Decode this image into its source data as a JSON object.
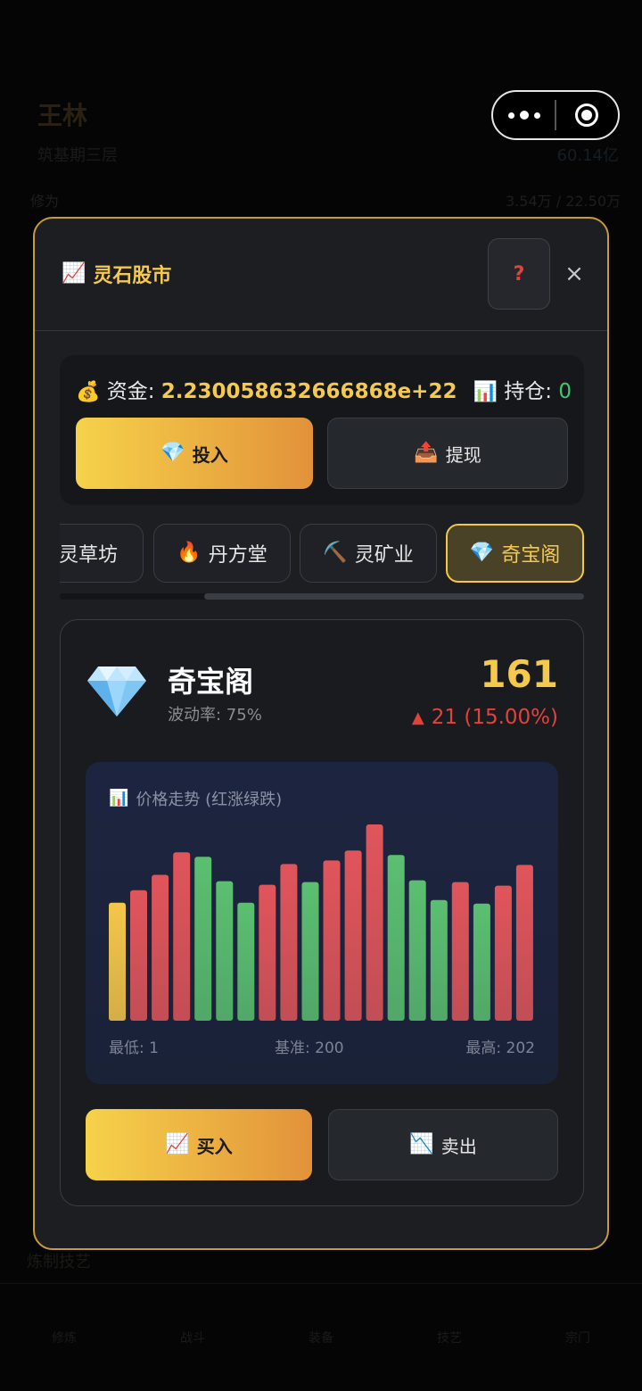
{
  "background": {
    "user_name": "王林",
    "subtitle": "筑基期三层",
    "stat_label": "修为",
    "stat_value": "3.54万 / 22.50万",
    "gems": "60.14亿",
    "section": "炼制技艺",
    "nav": [
      "修炼",
      "战斗",
      "装备",
      "技艺",
      "宗门"
    ]
  },
  "modal": {
    "title": "灵石股市",
    "title_icon": "chart-up-icon",
    "help_label": "?",
    "close_label": "×"
  },
  "funds": {
    "funds_label": "资金:",
    "funds_value": "2.230058632666868e+22",
    "hold_label": "持仓:",
    "hold_value": "0",
    "invest_label": "投入",
    "withdraw_label": "提现"
  },
  "tabs": [
    {
      "label": "灵草坊",
      "icon": "herb-icon",
      "active": false
    },
    {
      "label": "丹方堂",
      "icon": "fire-icon",
      "active": false
    },
    {
      "label": "灵矿业",
      "icon": "pickaxe-icon",
      "active": false
    },
    {
      "label": "奇宝阁",
      "icon": "gem-icon",
      "active": true
    }
  ],
  "stock": {
    "name": "奇宝阁",
    "volatility": "波动率: 75%",
    "price": "161",
    "change": "21 (15.00%)",
    "change_arrow": "▲",
    "buy_label": "买入",
    "sell_label": "卖出"
  },
  "chart_data": {
    "type": "bar",
    "title": "价格走势 (红涨绿跌)",
    "min_label": "最低: 1",
    "base_label": "基准: 200",
    "max_label": "最高: 202",
    "values": [
      131,
      145,
      162,
      187,
      182,
      155,
      131,
      151,
      174,
      154,
      178,
      189,
      218,
      184,
      156,
      134,
      154,
      130,
      150,
      173
    ],
    "colors": [
      "yellow",
      "red",
      "red",
      "red",
      "green",
      "green",
      "green",
      "red",
      "red",
      "green",
      "red",
      "red",
      "red",
      "green",
      "green",
      "green",
      "red",
      "green",
      "red",
      "red"
    ],
    "palette": {
      "yellow": "#f4c64a",
      "red": "#e0555a",
      "green": "#5bbf70"
    }
  }
}
